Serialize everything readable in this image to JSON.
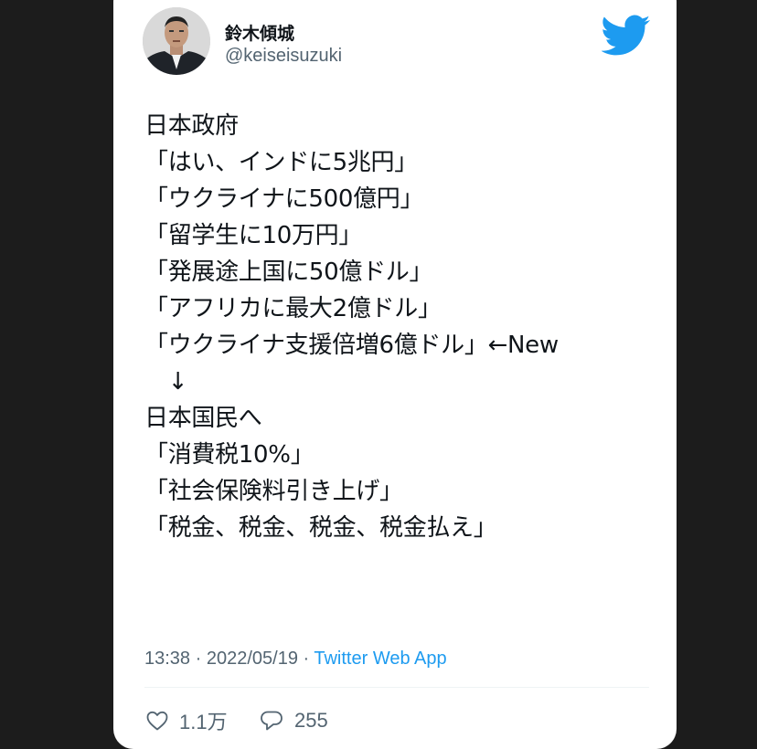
{
  "user": {
    "name": "鈴木傾城",
    "handle": "@keiseisuzuki"
  },
  "icons": {
    "avatar": "profile-photo",
    "logo": "twitter-bird-icon",
    "like": "heart-icon",
    "reply": "reply-bubble-icon"
  },
  "colors": {
    "accent": "#1d9bf0",
    "text": "#0f1419",
    "muted": "#536471"
  },
  "tweet": {
    "lines": [
      "日本政府",
      "「はい、インドに5兆円」",
      "「ウクライナに500億円」",
      "「留学生に10万円」",
      "「発展途上国に50億ドル」",
      "「アフリカに最大2億ドル」",
      "「ウクライナ支援倍増6億ドル」←New",
      "　↓",
      "日本国民へ",
      "「消費税10%」",
      "「社会保険料引き上げ」",
      "「税金、税金、税金、税金払え」"
    ]
  },
  "meta": {
    "time": "13:38",
    "date": "2022/05/19",
    "separator": " · ",
    "source": "Twitter Web App"
  },
  "stats": {
    "likes": "1.1万",
    "replies": "255"
  }
}
